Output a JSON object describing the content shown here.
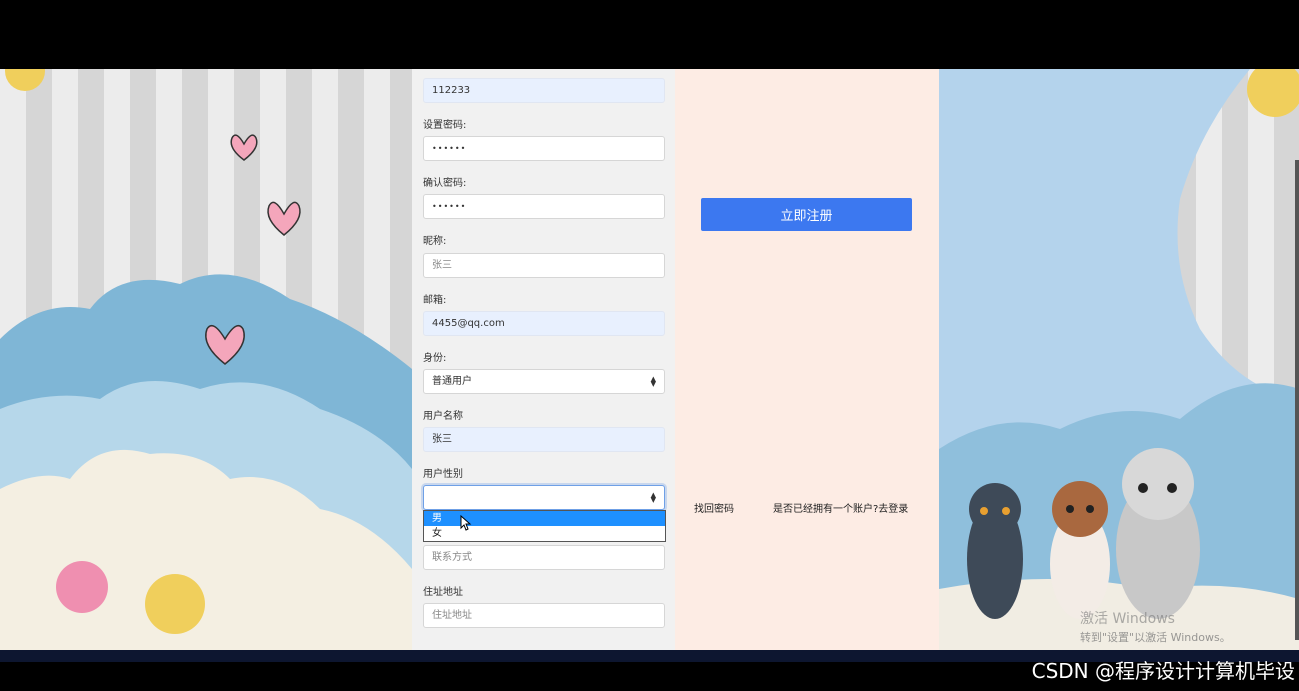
{
  "form": {
    "top_value": "112233",
    "password_label": "设置密码:",
    "password_value": "••••••",
    "confirm_label": "确认密码:",
    "confirm_value": "••••••",
    "nickname_label": "昵称:",
    "nickname_placeholder": "张三",
    "email_label": "邮箱:",
    "email_value": "4455@qq.com",
    "role_label": "身份:",
    "role_value": "普通用户",
    "username_label": "用户名称",
    "username_value": "张三",
    "gender_label": "用户性别",
    "gender_value": "",
    "gender_options": [
      "男",
      "女"
    ],
    "contact_placeholder": "联系方式",
    "address_label": "住址地址",
    "address_placeholder": "住址地址"
  },
  "actions": {
    "register_label": "立即注册",
    "forgot_password": "找回密码",
    "has_account_login": "是否已经拥有一个账户?去登录"
  },
  "overlay": {
    "windows_activate": "激活 Windows",
    "windows_activate_sub": "转到\"设置\"以激活 Windows。",
    "watermark": "CSDN @程序设计计算机毕设"
  },
  "colors": {
    "primary_button": "#3c78f0",
    "selected_option": "#1e90ff",
    "autofill_bg": "#e8f0fe"
  }
}
